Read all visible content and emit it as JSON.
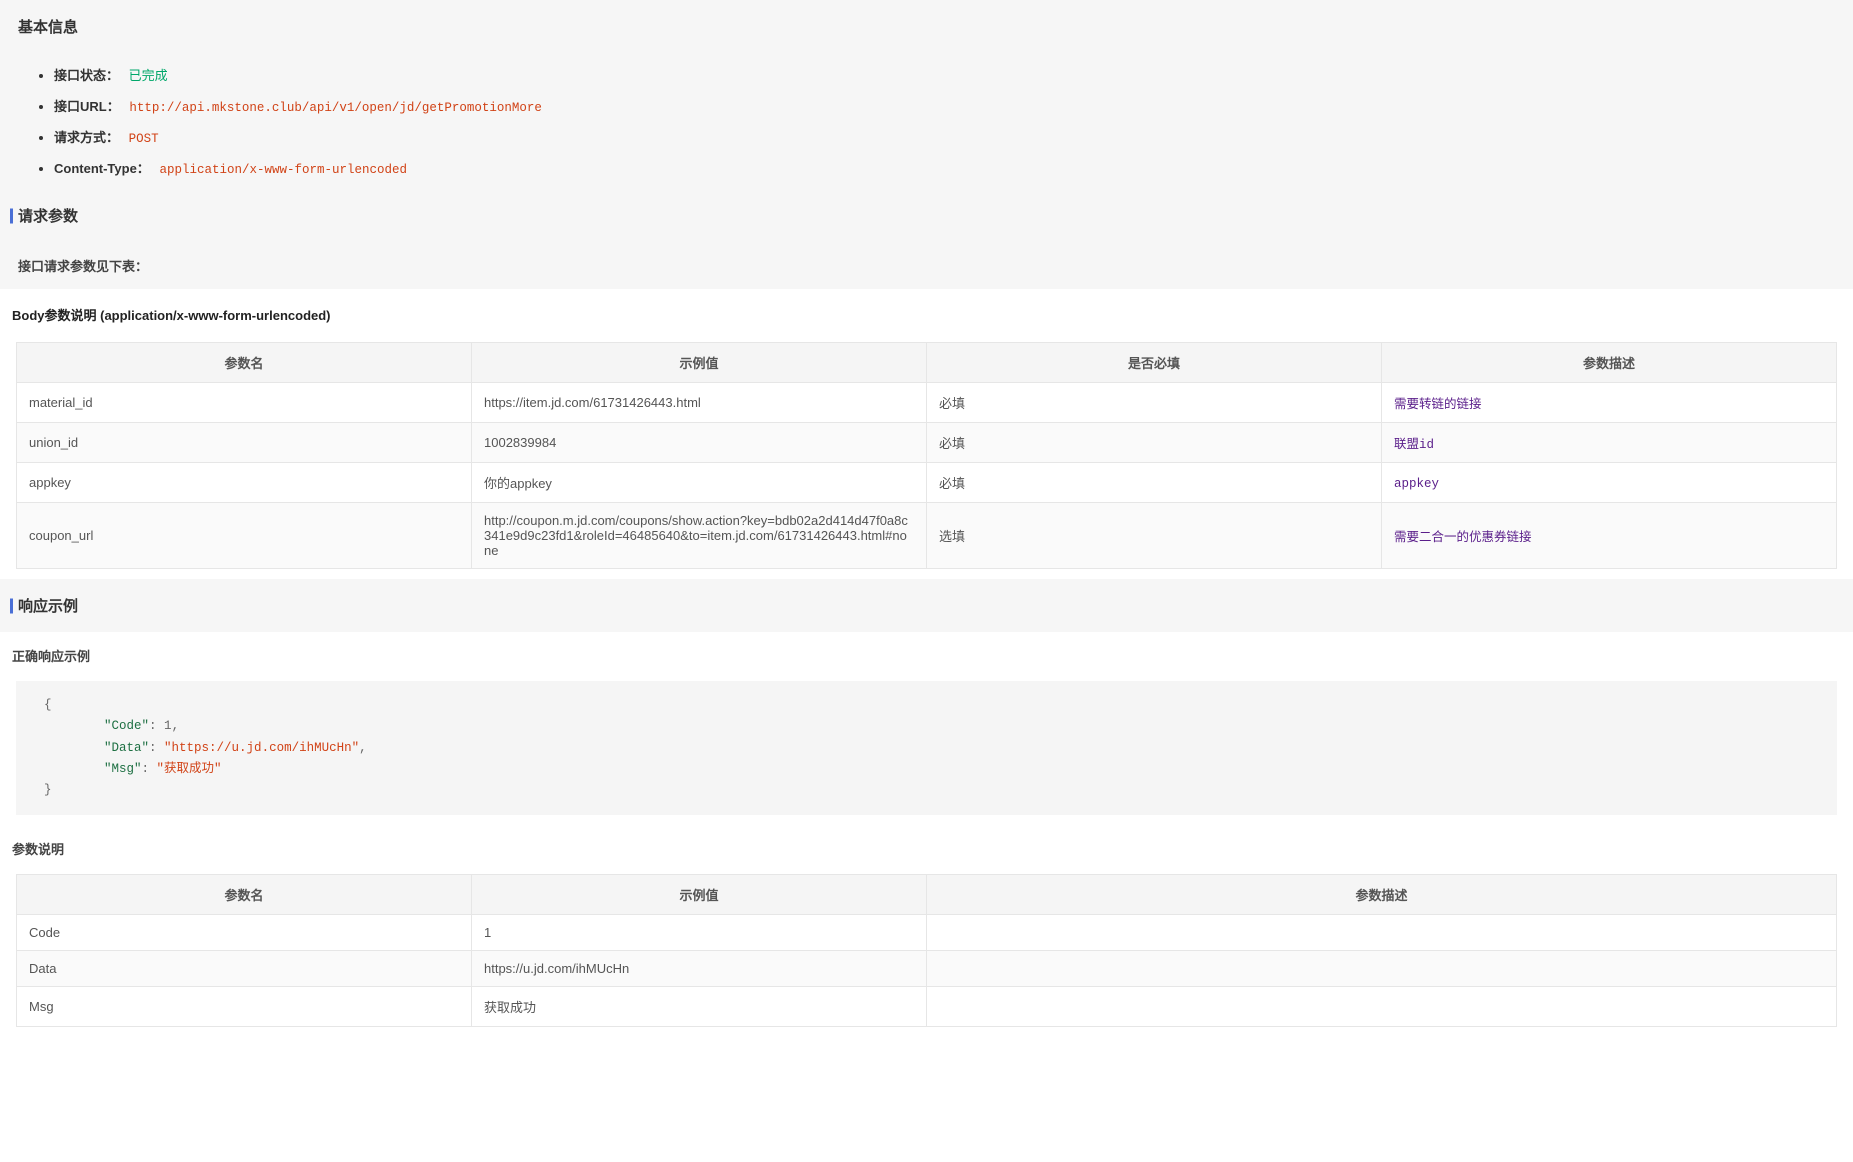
{
  "basic": {
    "title": "基本信息",
    "items": [
      {
        "label": "接口状态：",
        "value": "已完成",
        "style": "green"
      },
      {
        "label": "接口URL：",
        "value": "http://api.mkstone.club/api/v1/open/jd/getPromotionMore",
        "style": "code"
      },
      {
        "label": "请求方式：",
        "value": "POST",
        "style": "code"
      },
      {
        "label": "Content-Type：",
        "value": "application/x-www-form-urlencoded",
        "style": "code"
      }
    ]
  },
  "request": {
    "title": "请求参数",
    "caption": "接口请求参数见下表：",
    "body_heading": "Body参数说明 (application/x-www-form-urlencoded)",
    "columns": [
      "参数名",
      "示例值",
      "是否必填",
      "参数描述"
    ],
    "rows": [
      {
        "name": "material_id",
        "example": "https://item.jd.com/61731426443.html",
        "required": "必填",
        "desc": "需要转链的链接"
      },
      {
        "name": "union_id",
        "example": "1002839984",
        "required": "必填",
        "desc": "联盟id"
      },
      {
        "name": "appkey",
        "example": "你的appkey",
        "required": "必填",
        "desc": "appkey"
      },
      {
        "name": "coupon_url",
        "example": "http://coupon.m.jd.com/coupons/show.action?key=bdb02a2d414d47f0a8c341e9d9c23fd1&roleId=46485640&to=item.jd.com/61731426443.html#none",
        "required": "选填",
        "desc": "需要二合一的优惠券链接"
      }
    ]
  },
  "response": {
    "title": "响应示例",
    "ok_heading": "正确响应示例",
    "json_example": {
      "Code": 1,
      "Data": "https://u.jd.com/ihMUcHn",
      "Msg": "获取成功"
    },
    "param_heading": "参数说明",
    "columns": [
      "参数名",
      "示例值",
      "参数描述"
    ],
    "rows": [
      {
        "name": "Code",
        "example": "1",
        "desc": ""
      },
      {
        "name": "Data",
        "example": "https://u.jd.com/ihMUcHn",
        "desc": ""
      },
      {
        "name": "Msg",
        "example": "获取成功",
        "desc": ""
      }
    ]
  }
}
